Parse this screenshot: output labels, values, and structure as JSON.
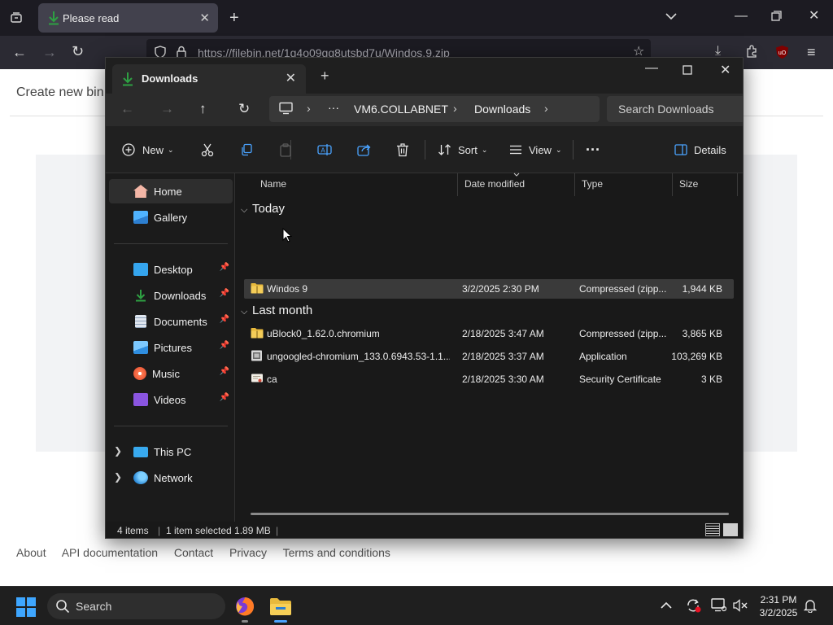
{
  "browser": {
    "tab_title": "Please read",
    "url": "https://filebin.net/1q4o09qq8utsbd7u/Windos.9.zip"
  },
  "page": {
    "create_bin": "Create new bin",
    "footer": [
      "About",
      "API documentation",
      "Contact",
      "Privacy",
      "Terms and conditions"
    ]
  },
  "explorer": {
    "tab_title": "Downloads",
    "breadcrumb": [
      "VM6.COLLABNET",
      "Downloads"
    ],
    "breadcrumb_more": "···",
    "search_placeholder": "Search Downloads",
    "commands": {
      "new": "New",
      "sort": "Sort",
      "view": "View",
      "more": "···",
      "details": "Details"
    },
    "sidebar": {
      "home": "Home",
      "gallery": "Gallery",
      "desktop": "Desktop",
      "downloads": "Downloads",
      "documents": "Documents",
      "pictures": "Pictures",
      "music": "Music",
      "videos": "Videos",
      "this_pc": "This PC",
      "network": "Network"
    },
    "columns": {
      "name": "Name",
      "date": "Date modified",
      "type": "Type",
      "size": "Size"
    },
    "groups": {
      "today": "Today",
      "last_month": "Last month"
    },
    "files": [
      {
        "name": "Windos 9",
        "date": "3/2/2025 2:30 PM",
        "type": "Compressed (zipp...",
        "size": "1,944 KB"
      },
      {
        "name": "uBlock0_1.62.0.chromium",
        "date": "2/18/2025 3:47 AM",
        "type": "Compressed (zipp...",
        "size": "3,865 KB"
      },
      {
        "name": "ungoogled-chromium_133.0.6943.53-1.1...",
        "date": "2/18/2025 3:37 AM",
        "type": "Application",
        "size": "103,269 KB"
      },
      {
        "name": "ca",
        "date": "2/18/2025 3:30 AM",
        "type": "Security Certificate",
        "size": "3 KB"
      }
    ],
    "status": {
      "items": "4 items",
      "selected": "1 item selected  1.89 MB"
    }
  },
  "taskbar": {
    "search": "Search",
    "time": "2:31 PM",
    "date": "3/2/2025"
  },
  "colors": {
    "accent": "#0078d4",
    "download_green": "#2ea043",
    "folder_yellow": "#e8b93c"
  }
}
